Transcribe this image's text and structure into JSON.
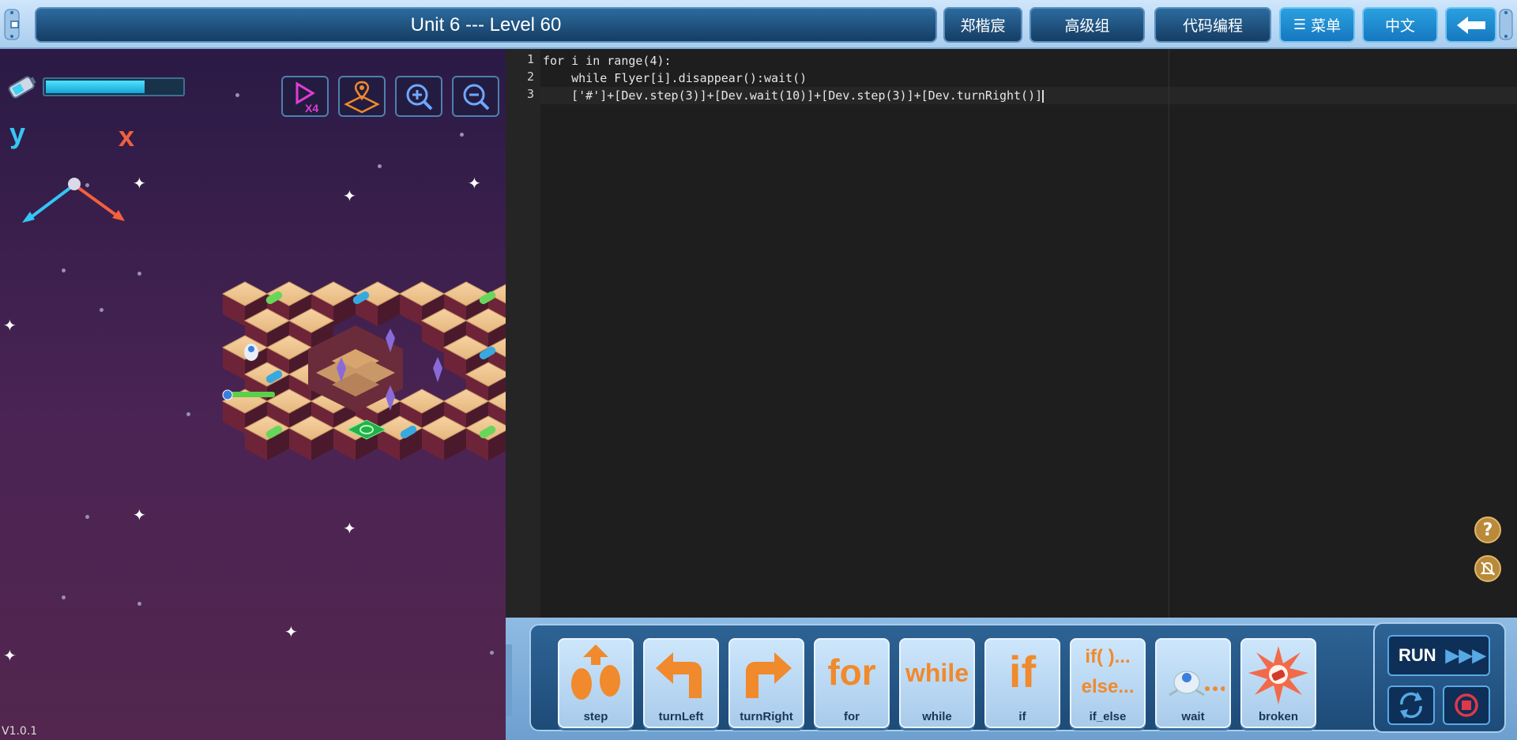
{
  "header": {
    "level_title": "Unit 6 --- Level 60",
    "user_name": "郑楷宸",
    "group": "高级组",
    "mode": "代码编程",
    "menu_label": "菜单",
    "language": "中文"
  },
  "game": {
    "energy_level": 0.72,
    "axis_y": "y",
    "axis_x": "x",
    "tools": [
      "speed-x4-icon",
      "map-icon",
      "zoom-in-icon",
      "zoom-out-icon"
    ],
    "speed_label": "X4",
    "version": "V1.0.1"
  },
  "editor": {
    "line_numbers": [
      "1",
      "2",
      "3"
    ],
    "lines": [
      "for i in range(4):",
      "    while Flyer[i].disappear():wait()",
      "    ['#']+[Dev.step(3)]+[Dev.wait(10)]+[Dev.step(3)]+[Dev.turnRight()]"
    ]
  },
  "blocks": {
    "items": [
      {
        "label": "step"
      },
      {
        "label": "turnLeft"
      },
      {
        "label": "turnRight"
      },
      {
        "label": "for",
        "glyph": "for"
      },
      {
        "label": "while",
        "glyph": "while"
      },
      {
        "label": "if",
        "glyph": "if"
      },
      {
        "label": "if_else",
        "glyph_top": "if( )...",
        "glyph_bottom": "else..."
      },
      {
        "label": "wait"
      },
      {
        "label": "broken"
      }
    ],
    "run_label": "RUN"
  },
  "colors": {
    "accent": "#1678c0",
    "block_text": "#f08a2c",
    "energy": "#2fc4ee"
  }
}
